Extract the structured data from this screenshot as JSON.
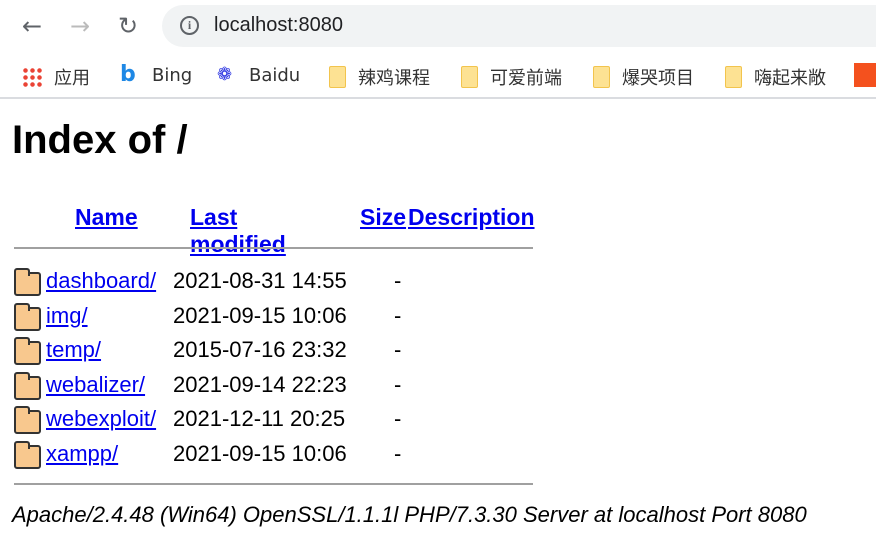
{
  "browser": {
    "url": "localhost:8080",
    "bookmarks": [
      {
        "label": "应用",
        "icon": "apps-grid-icon"
      },
      {
        "label": "Bing",
        "icon": "bing-icon"
      },
      {
        "label": "Baidu",
        "icon": "baidu-paw-icon"
      },
      {
        "label": "辣鸡课程",
        "icon": "folder-icon"
      },
      {
        "label": "可爱前端",
        "icon": "folder-icon"
      },
      {
        "label": "爆哭项目",
        "icon": "folder-icon"
      },
      {
        "label": "嗨起来敞",
        "icon": "folder-icon"
      }
    ]
  },
  "page": {
    "title": "Index of /",
    "columns": {
      "name": "Name",
      "modified": "Last modified",
      "size": "Size",
      "description": "Description"
    },
    "rows": [
      {
        "name": "dashboard/",
        "modified": "2021-08-31 14:55",
        "size": "-"
      },
      {
        "name": "img/",
        "modified": "2021-09-15 10:06",
        "size": "-"
      },
      {
        "name": "temp/",
        "modified": "2015-07-16 23:32",
        "size": "-"
      },
      {
        "name": "webalizer/",
        "modified": "2021-09-14 22:23",
        "size": "-"
      },
      {
        "name": "webexploit/",
        "modified": "2021-12-11 20:25",
        "size": "-"
      },
      {
        "name": "xampp/",
        "modified": "2021-09-15 10:06",
        "size": "-"
      }
    ],
    "footer": "Apache/2.4.48 (Win64) OpenSSL/1.1.1l PHP/7.3.30 Server at localhost Port 8080"
  }
}
